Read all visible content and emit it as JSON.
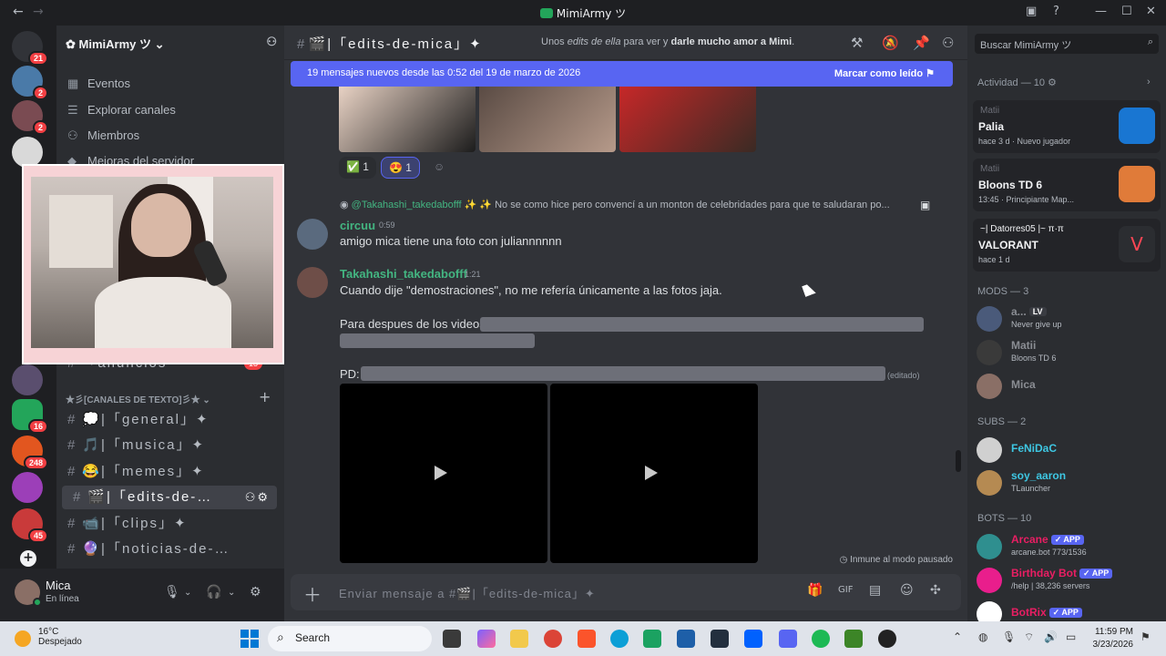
{
  "window": {
    "title": "MimiArmy ツ"
  },
  "server": {
    "name": "MimiArmy ツ",
    "links": [
      "Eventos",
      "Explorar canales",
      "Miembros",
      "Mejoras del servidor"
    ],
    "partial_channel": "「anuncios-",
    "partial_channel_badge": "15",
    "category": "★彡[CANALES DE TEXTO]彡★",
    "channels": [
      {
        "emoji": "💭",
        "name": "「general」✦"
      },
      {
        "emoji": "🎵",
        "name": "「musica」✦"
      },
      {
        "emoji": "😂",
        "name": "「memes」✦"
      },
      {
        "emoji": "🎬",
        "name": "「edits-de-…"
      },
      {
        "emoji": "📹",
        "name": "「clips」✦"
      },
      {
        "emoji": "🔮",
        "name": "「noticias-de-…"
      }
    ]
  },
  "rail_badges": [
    "21",
    "2",
    "2",
    "16",
    "248",
    "45"
  ],
  "user": {
    "name": "Mica",
    "status": "En línea"
  },
  "chat": {
    "channel": "「edits-de-mica」✦",
    "topic_pre": "Unos ",
    "topic_em": "edits de ella",
    "topic_mid": " para ver y ",
    "topic_bold": "darle mucho amor a Mimi",
    "topic_end": ".",
    "new_bar": "19 mensajes nuevos desde las 0:52 del 19 de marzo de 2026",
    "mark_read": "Marcar como leído",
    "reactions": [
      {
        "emoji": "✅",
        "count": "1"
      },
      {
        "emoji": "😍",
        "count": "1"
      }
    ],
    "reply": {
      "user": "@Takahashi_takedabofff",
      "text": "✨ ✨ No se como hice pero convencí a un monton de celebridades para que te saludaran po..."
    },
    "messages": [
      {
        "user": "circuu",
        "time": "0:59",
        "text": "amigo mica tiene una foto con juliannnnnn"
      },
      {
        "user": "Takahashi_takedabofff",
        "time": "1:21",
        "text": "Cuando dije \"demostraciones\", no me refería únicamente a las fotos jaja.",
        "line2": "Para despues de los videos:",
        "line3": "PD:",
        "edited": "(editado)"
      }
    ],
    "immune": "Inmune al modo pausado",
    "composer_placeholder": "Enviar mensaje a #🎬|「edits-de-mica」✦"
  },
  "members": {
    "search_placeholder": "Buscar MimiArmy ツ",
    "activity_header": "Actividad — 10",
    "activities": [
      {
        "user": "Matii",
        "game": "Palia",
        "meta": "hace 3 d · Nuevo jugador"
      },
      {
        "user": "Matii",
        "game": "Bloons TD 6",
        "meta": "13:45 · Principiante Map..."
      },
      {
        "user": "~| Datorres05 |~ π·π",
        "game": "VALORANT",
        "meta": "hace 1 d"
      }
    ],
    "mods_header": "MODS — 3",
    "mods": [
      {
        "name": "a...",
        "tag": "LV",
        "sub": "Never give up"
      },
      {
        "name": "Matii",
        "sub": "Bloons TD 6"
      },
      {
        "name": "Mica",
        "sub": ""
      }
    ],
    "subs_header": "SUBS — 2",
    "subs": [
      {
        "name": "FeNiDaC",
        "sub": ""
      },
      {
        "name": "soy_aaron",
        "sub": "TLauncher"
      }
    ],
    "bots_header": "BOTS — 10",
    "bots": [
      {
        "name": "Arcane",
        "tag": "✓ APP",
        "sub": "arcane.bot 773/1536"
      },
      {
        "name": "Birthday Bot",
        "tag": "✓ APP",
        "sub": "/help | 38,236 servers"
      },
      {
        "name": "BotRix",
        "tag": "✓ APP",
        "sub": ""
      }
    ]
  },
  "taskbar": {
    "temp": "16°C",
    "weather": "Despejado",
    "search": "Search",
    "time": "11:59 PM",
    "date": "3/23/2026"
  },
  "colors": {
    "accent": "#5865f2",
    "online": "#23a55a",
    "mod": "#a0a0a0",
    "sub": "#3ec7e3",
    "bot": "#e91e63"
  }
}
